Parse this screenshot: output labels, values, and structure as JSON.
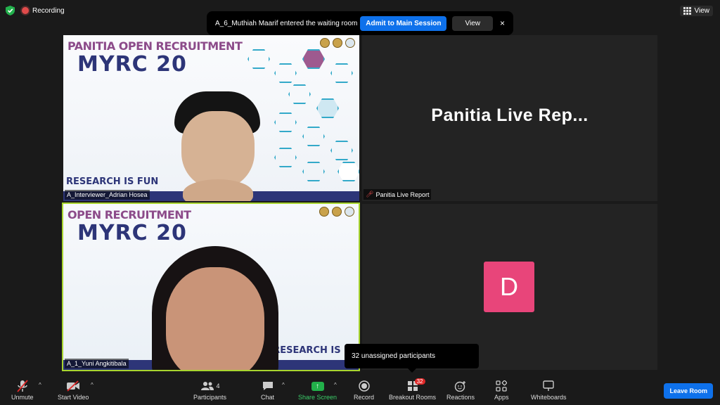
{
  "top": {
    "recording_label": "Recording",
    "view_label": "View"
  },
  "notification": {
    "message": "A_6_Muthiah Maarif entered the waiting room",
    "admit_label": "Admit to Main Session",
    "view_label": "View",
    "close_glyph": "×"
  },
  "tiles": {
    "t1": {
      "name": "A_Interviewer_Adrian Hosea",
      "slide_top": "PANITIA OPEN RECRUITMENT",
      "slide_big": "MYRC 20",
      "slide_footer": "RESEARCH IS FUN"
    },
    "t2": {
      "name": "Panitia Live Report",
      "center_text": "Panitia Live Rep..."
    },
    "t3": {
      "name": "A_1_Yuni Angkitibala",
      "slide_top": "OPEN RECRUITMENT",
      "slide_big": "MYRC 20",
      "slide_footer": "RESEARCH IS F"
    },
    "t4": {
      "avatar_letter": "D"
    }
  },
  "tooltip": {
    "text": "32 unassigned participants"
  },
  "toolbar": {
    "unmute": "Unmute",
    "start_video": "Start Video",
    "participants": "Participants",
    "participants_count": "4",
    "chat": "Chat",
    "share_screen": "Share Screen",
    "record": "Record",
    "breakout_rooms": "Breakout Rooms",
    "breakout_count": "32",
    "reactions": "Reactions",
    "apps": "Apps",
    "whiteboards": "Whiteboards",
    "leave": "Leave Room"
  },
  "colors": {
    "admit_blue": "#0e71eb",
    "active_speaker_border": "#a8d52f",
    "avatar_pink": "#e8457a",
    "share_green": "#22b04a",
    "badge_red": "#e02828"
  }
}
